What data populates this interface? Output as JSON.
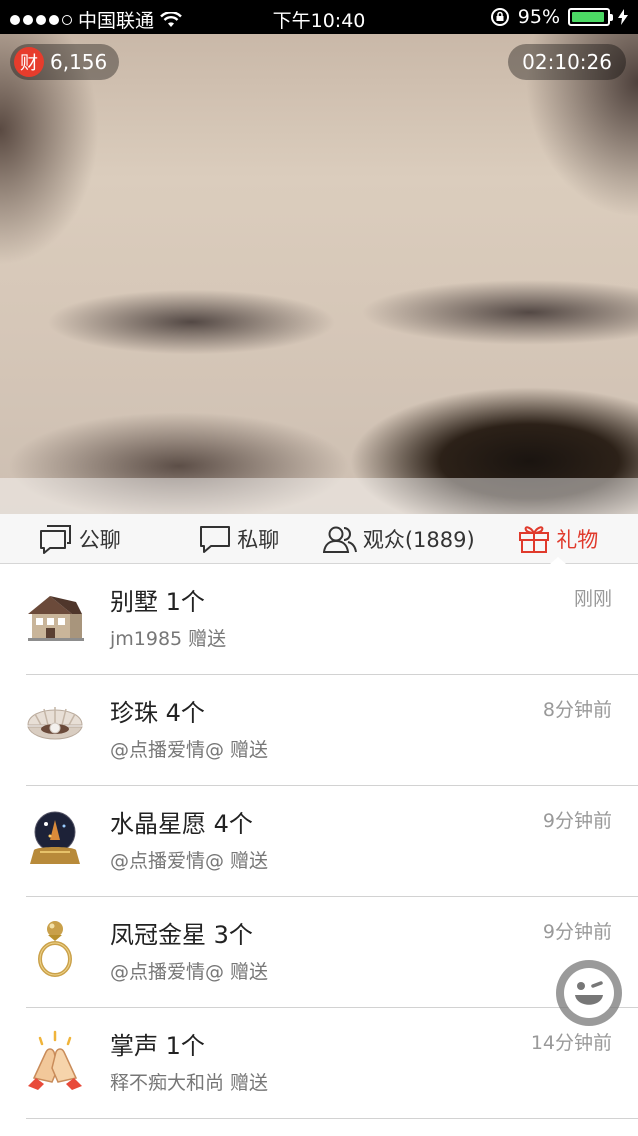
{
  "status_bar": {
    "carrier": "中国联通",
    "time": "下午10:40",
    "battery_percent": "95%",
    "battery_level": 0.95
  },
  "video": {
    "rich_icon_label": "财",
    "rich_value": "6,156",
    "duration": "02:10:26",
    "ticker_fragment": ")"
  },
  "tabs": [
    {
      "label": "公聊",
      "icon": "chat-bubbles-icon",
      "active": false
    },
    {
      "label": "私聊",
      "icon": "chat-bubble-icon",
      "active": false
    },
    {
      "label": "观众(1889)",
      "icon": "users-icon",
      "active": false
    },
    {
      "label": "礼物",
      "icon": "gift-icon",
      "active": true
    }
  ],
  "gifts": [
    {
      "name": "别墅 1个",
      "from": "jm1985 赠送",
      "time": "刚刚",
      "icon": "villa-icon"
    },
    {
      "name": "珍珠 4个",
      "from": "@点播爱情@ 赠送",
      "time": "8分钟前",
      "icon": "pearl-shell-icon"
    },
    {
      "name": "水晶星愿 4个",
      "from": "@点播爱情@ 赠送",
      "time": "9分钟前",
      "icon": "crystal-ball-icon"
    },
    {
      "name": "凤冠金星 3个",
      "from": "@点播爱情@ 赠送",
      "time": "9分钟前",
      "icon": "gold-ring-icon"
    },
    {
      "name": "掌声 1个",
      "from": "释不痴大和尚 赠送",
      "time": "14分钟前",
      "icon": "clapping-hands-icon"
    }
  ],
  "colors": {
    "accent": "#e03a2c",
    "battery_green": "#4cd964"
  }
}
